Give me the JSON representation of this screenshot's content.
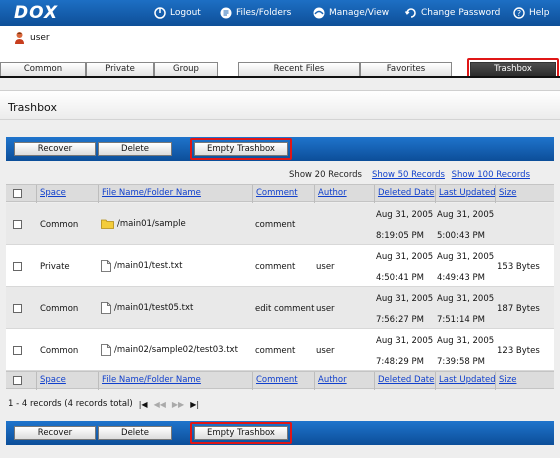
{
  "app": {
    "logo": "DOX"
  },
  "topnav": [
    {
      "label": "Logout",
      "icon": "logout-icon"
    },
    {
      "label": "Files/Folders",
      "icon": "files-icon"
    },
    {
      "label": "Manage/View",
      "icon": "manage-icon"
    },
    {
      "label": "Change Password",
      "icon": "password-icon"
    },
    {
      "label": "Help",
      "icon": "help-icon"
    }
  ],
  "user": {
    "name": "user",
    "icon": "user-icon"
  },
  "tabs": [
    "Common",
    "Private",
    "Group",
    "Recent Files",
    "Favorites",
    "Trashbox"
  ],
  "active_tab": "Trashbox",
  "page": {
    "title": "Trashbox"
  },
  "actions": {
    "recover": "Recover",
    "delete": "Delete",
    "empty": "Empty Trashbox"
  },
  "records_display": {
    "current": "Show 20 Records",
    "opt50": "Show 50 Records",
    "opt100": "Show 100 Records"
  },
  "columns": [
    "Space",
    "File Name/Folder Name",
    "Comment",
    "Author",
    "Deleted Date",
    "Last Updated",
    "Size"
  ],
  "rows": [
    {
      "space": "Common",
      "name": "/main01/sample",
      "type": "folder",
      "comment": "comment",
      "author": "",
      "deleted_date": "Aug 31, 2005",
      "deleted_time": "8:19:05 PM",
      "updated_date": "Aug 31, 2005",
      "updated_time": "5:00:43 PM",
      "size": ""
    },
    {
      "space": "Private",
      "name": "/main01/test.txt",
      "type": "file",
      "comment": "comment",
      "author": "user",
      "deleted_date": "Aug 31, 2005",
      "deleted_time": "4:50:41 PM",
      "updated_date": "Aug 31, 2005",
      "updated_time": "4:49:43 PM",
      "size": "153 Bytes"
    },
    {
      "space": "Common",
      "name": "/main01/test05.txt",
      "type": "file",
      "comment": "edit comment",
      "author": "user",
      "deleted_date": "Aug 31, 2005",
      "deleted_time": "7:56:27 PM",
      "updated_date": "Aug 31, 2005",
      "updated_time": "7:51:14 PM",
      "size": "187 Bytes"
    },
    {
      "space": "Common",
      "name": "/main02/sample02/test03.txt",
      "type": "file",
      "comment": "comment",
      "author": "user",
      "deleted_date": "Aug 31, 2005",
      "deleted_time": "7:48:29 PM",
      "updated_date": "Aug 31, 2005",
      "updated_time": "7:39:58 PM",
      "size": "123 Bytes"
    }
  ],
  "footer": {
    "summary": "1 - 4 records (4 records total)"
  },
  "colors": {
    "bar_blue": "#1f74cc",
    "highlight_red": "#e01616",
    "link": "#1140cc"
  }
}
